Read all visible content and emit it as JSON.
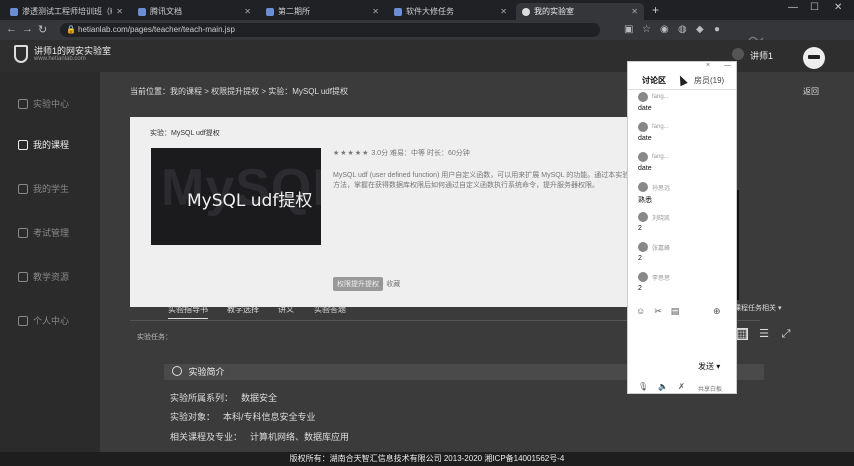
{
  "browser": {
    "tabs": [
      {
        "label": "渗透测试工程师培训班（Ka",
        "active": false
      },
      {
        "label": "腾讯文档",
        "active": false
      },
      {
        "label": "第二期所",
        "active": false
      },
      {
        "label": "软件大修任务",
        "active": false
      },
      {
        "label": "我的实验室",
        "active": true
      }
    ],
    "new_tab": "+",
    "url": "hetianlab.com/pages/teacher/teach-main.jsp",
    "window_buttons": [
      "—",
      "☐",
      "✕"
    ]
  },
  "header": {
    "brand_title": "讲师1的网安实验室",
    "brand_sub": "www.hetianlab.com",
    "user_name": "讲师1"
  },
  "sidebar": {
    "items": [
      {
        "label": "实验中心",
        "active": false
      },
      {
        "label": "我的课程",
        "active": true
      },
      {
        "label": "我的学生",
        "active": false
      },
      {
        "label": "考试管理",
        "active": false
      },
      {
        "label": "教学资源",
        "active": false
      },
      {
        "label": "个人中心",
        "active": false
      }
    ]
  },
  "main": {
    "breadcrumb": "当前位置：我的课程 > 权限提升提权 > 实验：MySQL udf提权",
    "back": "返回",
    "experiment_title": "实验：MySQL udf提权",
    "cover_bigtext": "MySQL",
    "cover_title": "MySQL udf提权",
    "stars": "★★★★★",
    "meta_text": "3.0分   难易：中等   时长：60分钟",
    "description": "MySQL udf (user defined function) 用户自定义函数，可以用来扩展 MySQL 的功能。通过本实验了解 udf 提权的原理和利用方法，掌握在获得数据库权限后如何通过自定义函数执行系统命令，提升服务器权限。",
    "tag": "权限提升提权",
    "favorite": "☆ 收藏",
    "tabs": [
      "实验指导书",
      "教学选择",
      "讲义",
      "实验答题"
    ],
    "layout_select": "课程任务相关 ▾",
    "task_label": "实验任务：",
    "section_title": "实验简介",
    "info_rows": [
      {
        "label": "实验所属系列：",
        "value": "数据安全"
      },
      {
        "label": "实验对象：",
        "value": "本科/专科信息安全专业"
      },
      {
        "label": "相关课程及专业：",
        "value": "计算机网络、数据库应用"
      }
    ]
  },
  "chat": {
    "tab_active": "讨论区",
    "tab_other": "房员(19)",
    "controls": [
      "×",
      "—"
    ],
    "messages": [
      {
        "user": "fang...",
        "text": "date"
      },
      {
        "user": "fang...",
        "text": "date"
      },
      {
        "user": "fang...",
        "text": "date"
      },
      {
        "user": "孙思远",
        "text": "熟悉"
      },
      {
        "user": "刘晓凯",
        "text": "2"
      },
      {
        "user": "张嘉峰",
        "text": "2"
      },
      {
        "user": "李思思",
        "text": "2"
      }
    ],
    "send_label": "发送",
    "send_arrow": "▾",
    "footer_label": "共享白板"
  },
  "footer": {
    "copyright": "版权所有：湖南合天智汇信息技术有限公司 2013-2020 湘ICP备14001562号-4"
  }
}
